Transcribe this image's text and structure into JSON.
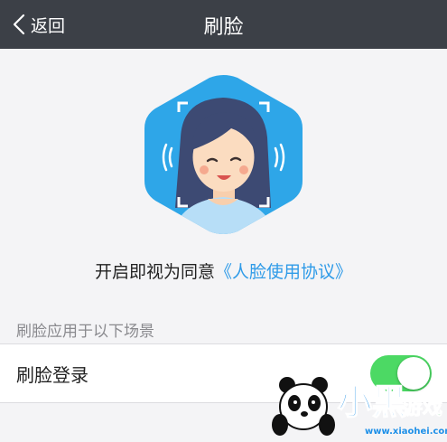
{
  "navbar": {
    "back_label": "返回",
    "title": "刷脸"
  },
  "hero": {
    "illustration": "face-scan-woman-winking",
    "accent_color": "#2ea6e8"
  },
  "consent": {
    "prefix": "开启即视为同意",
    "link_text": "《人脸使用协议》",
    "link_color": "#2f9be8"
  },
  "section": {
    "header": "刷脸应用于以下场景",
    "rows": [
      {
        "label": "刷脸登录",
        "toggle_on": true,
        "toggle_color": "#4cd964"
      }
    ]
  },
  "watermark": {
    "text_cn": "小黑游戏",
    "url_text": "www.xiaohei.com"
  }
}
